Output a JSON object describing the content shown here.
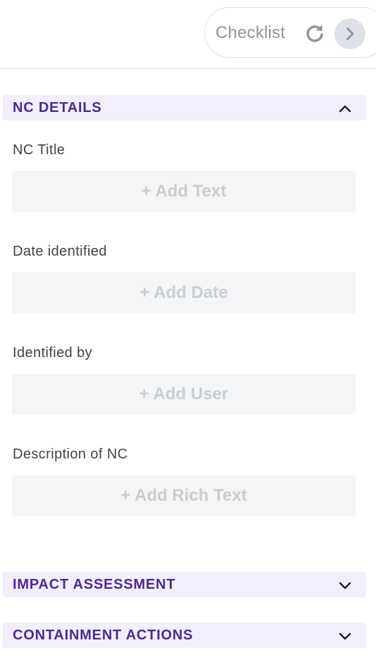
{
  "header": {
    "checklist_label": "Checklist",
    "icons": {
      "refresh": "refresh-icon",
      "next": "chevron-right-icon"
    }
  },
  "sections": [
    {
      "title": "NC DETAILS",
      "expanded": true,
      "fields": [
        {
          "label": "NC Title",
          "placeholder": "+ Add Text"
        },
        {
          "label": "Date identified",
          "placeholder": "+ Add Date"
        },
        {
          "label": "Identified by",
          "placeholder": "+ Add User"
        },
        {
          "label": "Description of NC",
          "placeholder": "+ Add Rich Text"
        }
      ]
    },
    {
      "title": "IMPACT ASSESSMENT",
      "expanded": false
    },
    {
      "title": "CONTAINMENT ACTIONS",
      "expanded": false
    }
  ],
  "colors": {
    "section_bg": "#f3eefb",
    "section_text": "#4c2a90",
    "field_bg": "#f4f5f6",
    "placeholder_text": "#c9cdd2"
  }
}
